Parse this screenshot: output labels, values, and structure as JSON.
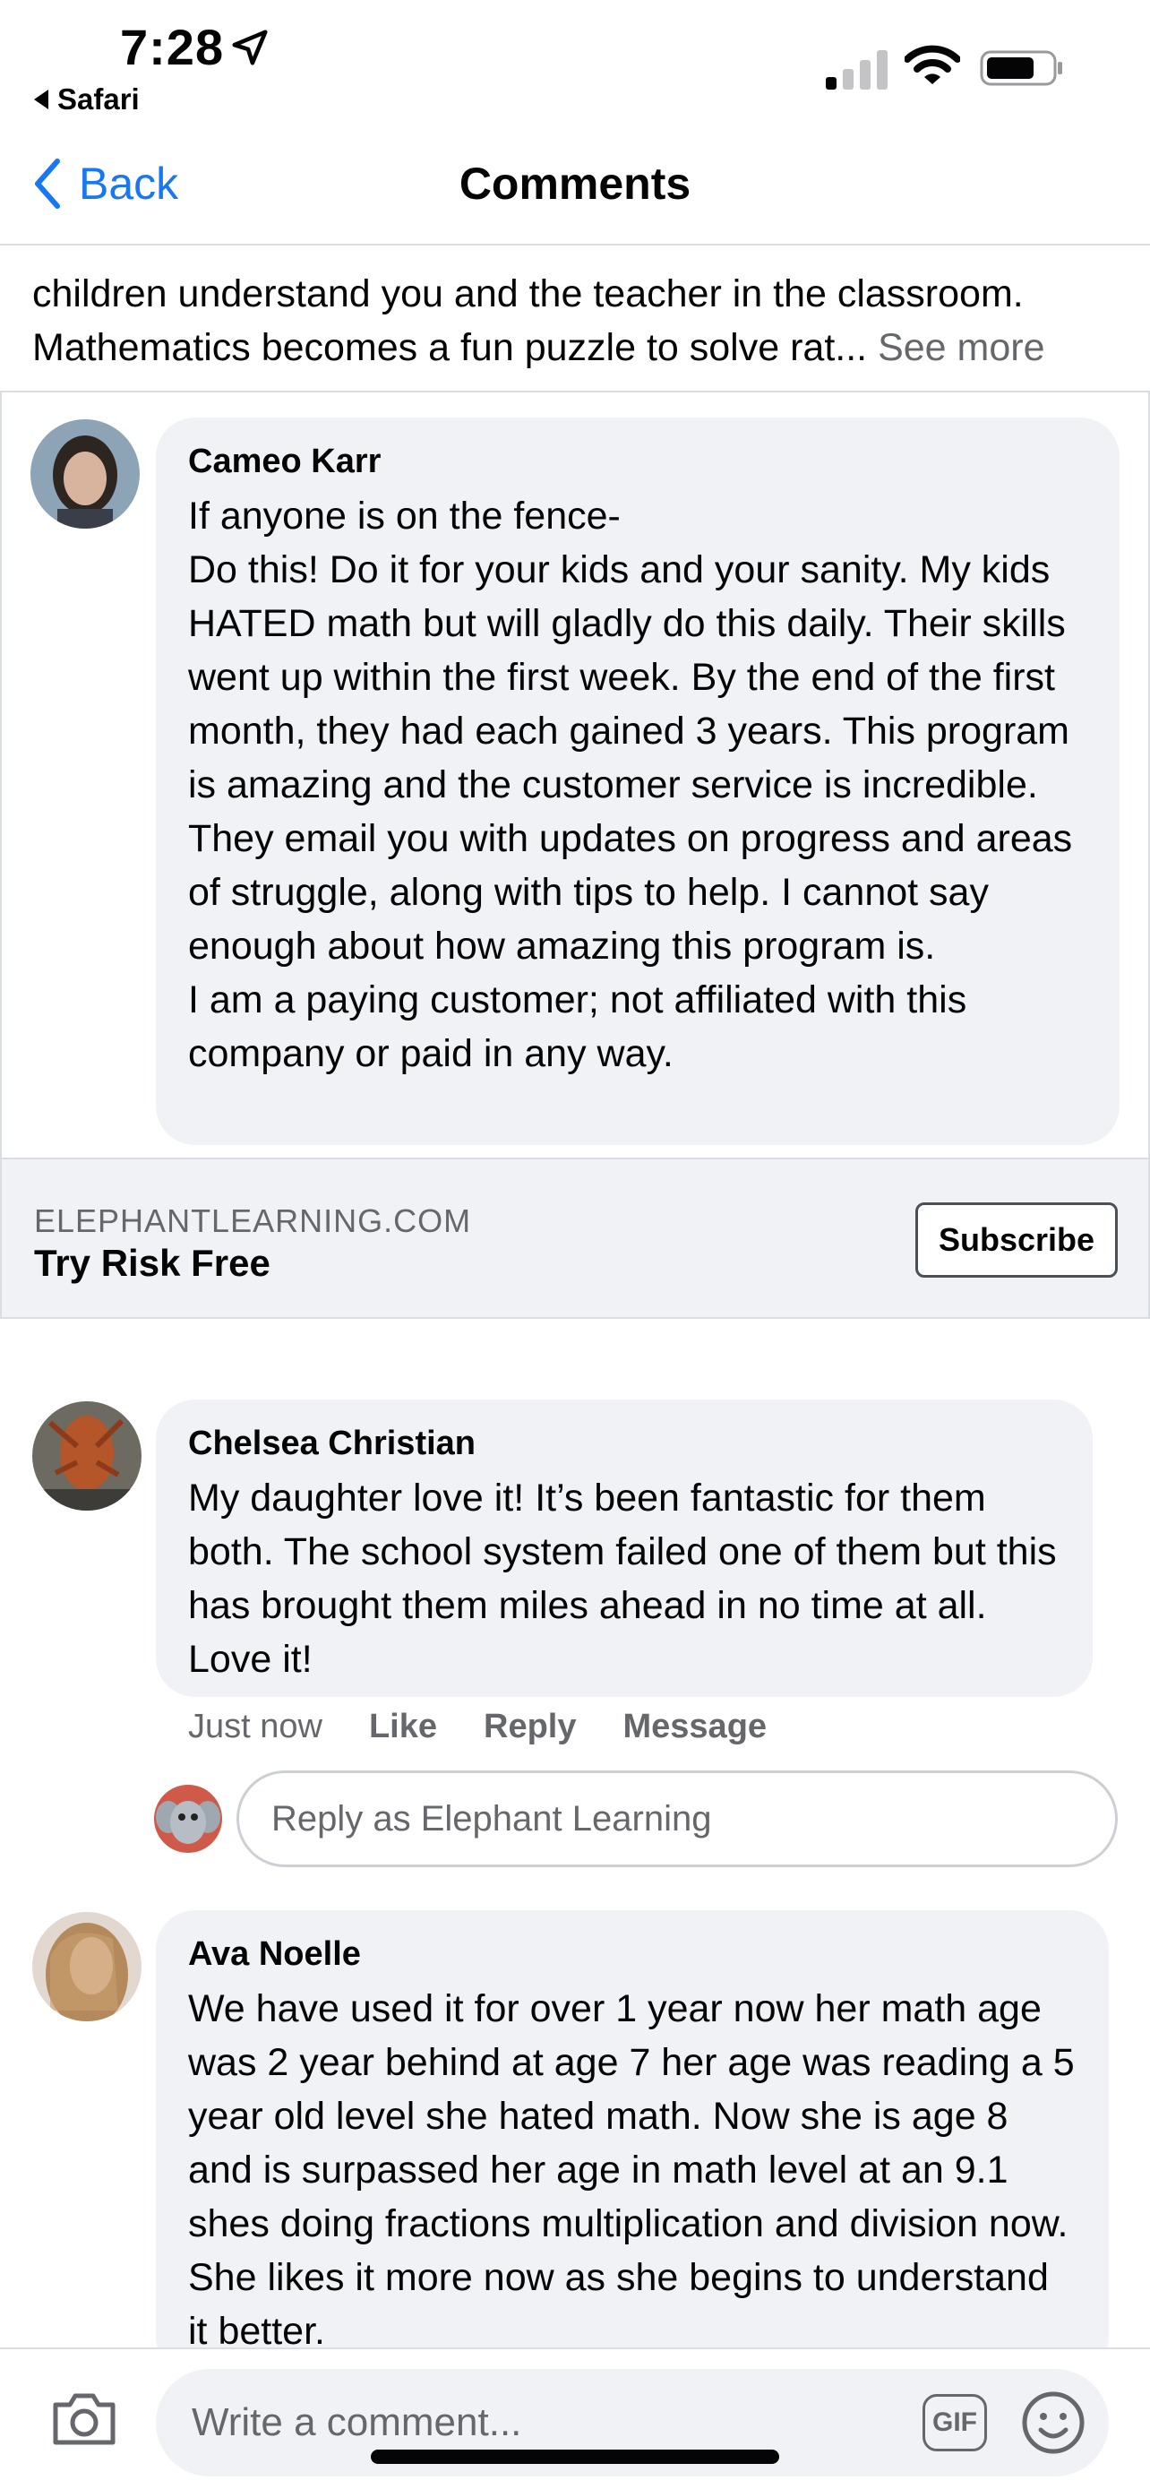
{
  "status_bar": {
    "time": "7:28",
    "back_app": "Safari"
  },
  "nav": {
    "back_label": "Back",
    "title": "Comments"
  },
  "post": {
    "text_line_1": "children understand you and the teacher in the classroom.",
    "text_line_2": "Mathematics becomes a fun puzzle to solve rat...",
    "see_more": "See more"
  },
  "ad": {
    "comment": {
      "author": "Cameo Karr",
      "text": "If anyone is on the fence-\nDo this! Do it for your kids and your sanity. My kids HATED math but will gladly do this daily. Their skills went up within the first week. By the end of the first month, they had each gained 3 years. This program is amazing and the customer service is incredible. They email you with updates on progress and areas of struggle, along with tips to help. I cannot say enough about how amazing this program is.\nI am a paying customer; not affiliated with this company or paid in any way."
    },
    "domain": "ELEPHANTLEARNING.COM",
    "cta_text": "Try Risk Free",
    "button_label": "Subscribe"
  },
  "comments": [
    {
      "author": "Chelsea Christian",
      "text": "My daughter love it! It’s been fantastic for them both. The school system failed one of them but this has brought them miles ahead in no time at all. Love it!",
      "timestamp": "Just now",
      "actions": [
        "Like",
        "Reply",
        "Message"
      ]
    },
    {
      "author": "Ava Noelle",
      "text": "We have used it for over 1 year now her math age was 2 year behind at age 7 her age was reading a 5 year old level she hated math. Now she is age 8 and is surpassed her age in math level at an 9.1 shes doing fractions multiplication and division now. She likes it more now as she begins to understand it better."
    }
  ],
  "reply_box": {
    "placeholder": "Reply as Elephant Learning"
  },
  "composer": {
    "placeholder": "Write a comment...",
    "gif_label": "GIF"
  },
  "colors": {
    "link_blue": "#1877f2",
    "bubble_bg": "#f0f2f5",
    "muted_text": "#65676b"
  }
}
